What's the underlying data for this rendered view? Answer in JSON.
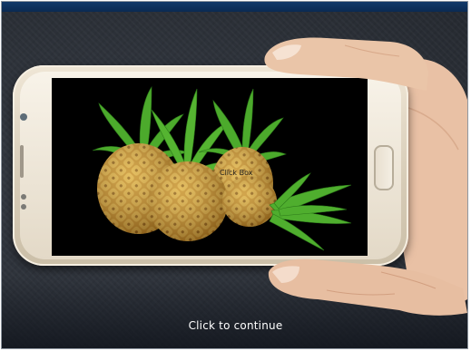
{
  "slide": {
    "click_box_label": "Click Box",
    "continue_label": "Click to continue"
  },
  "colors": {
    "background": "#2b3038",
    "top_bar": "#123a6a",
    "phone_body": "#e8dfcf",
    "screen": "#000000",
    "pineapple_body": "#c9962f",
    "pineapple_leaves": "#3f9b2a",
    "continue_text": "#ffffff"
  },
  "icons": {
    "image": "pineapples-image",
    "device": "smartphone-in-hand"
  }
}
